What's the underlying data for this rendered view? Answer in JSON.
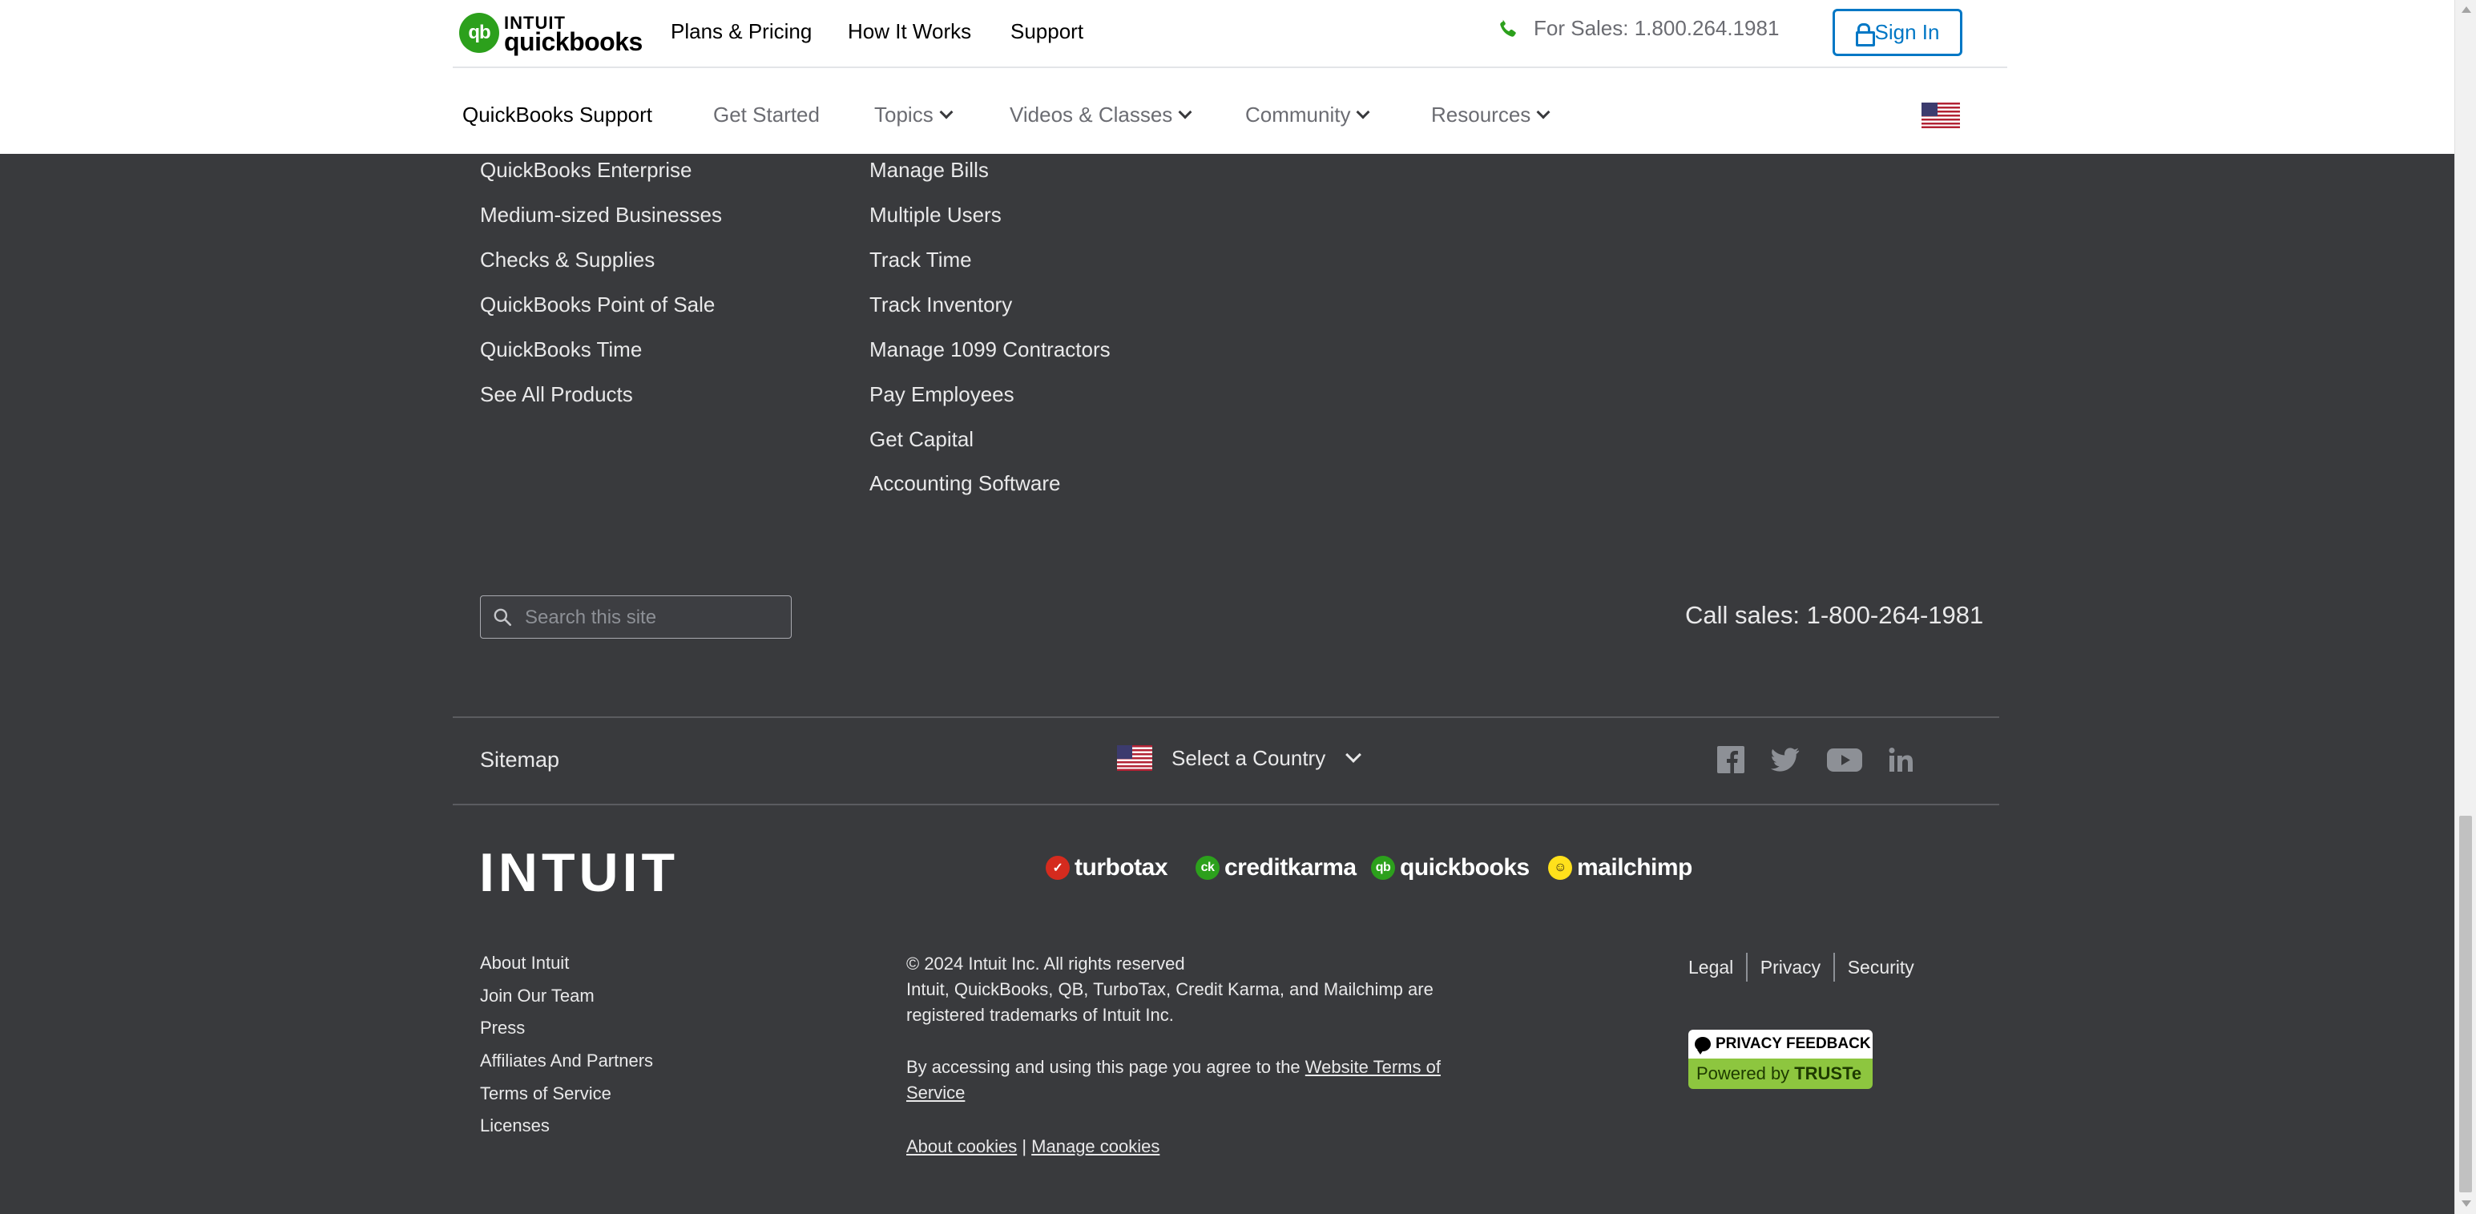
{
  "header": {
    "logo_intuit": "INTUIT",
    "logo_product": "quickbooks",
    "nav": [
      "Plans & Pricing",
      "How It Works",
      "Support"
    ],
    "sales_text": "For Sales: 1.800.264.1981",
    "sign_in": "Sign In"
  },
  "subnav": {
    "items": [
      {
        "label": "QuickBooks Support",
        "dropdown": false
      },
      {
        "label": "Get Started",
        "dropdown": false
      },
      {
        "label": "Topics",
        "dropdown": true
      },
      {
        "label": "Videos & Classes",
        "dropdown": true
      },
      {
        "label": "Community",
        "dropdown": true
      },
      {
        "label": "Resources",
        "dropdown": true
      }
    ]
  },
  "footer": {
    "products_col": [
      "QuickBooks Enterprise",
      "Medium-sized Businesses",
      "Checks & Supplies",
      "QuickBooks Point of Sale",
      "QuickBooks Time",
      "See All Products"
    ],
    "features_col": [
      "Manage Bills",
      "Multiple Users",
      "Track Time",
      "Track Inventory",
      "Manage 1099 Contractors",
      "Pay Employees",
      "Get Capital",
      "Accounting Software"
    ],
    "search_placeholder": "Search this site",
    "call_sales": "Call sales: 1-800-264-1981",
    "sitemap": "Sitemap",
    "select_country": "Select a Country",
    "social": [
      "facebook-icon",
      "twitter-icon",
      "youtube-icon",
      "linkedin-icon"
    ],
    "intuit_wordmark": "INTUIT",
    "brands": [
      {
        "name": "turbotax",
        "badge": "✓",
        "color": "#d52b1e"
      },
      {
        "name": "creditkarma",
        "badge": "ck",
        "color": "#2ca01c"
      },
      {
        "name": "quickbooks",
        "badge": "qb",
        "color": "#2ca01c"
      },
      {
        "name": "mailchimp",
        "badge": "☺",
        "color": "#ffe01b"
      }
    ],
    "company_links": [
      "About Intuit",
      "Join Our Team",
      "Press",
      "Affiliates And Partners",
      "Terms of Service",
      "Licenses"
    ],
    "copyright": "© 2024 Intuit Inc. All rights reserved",
    "trademarks": "Intuit, QuickBooks, QB, TurboTax, Credit Karma, and Mailchimp are registered trademarks of Intuit Inc.",
    "terms_prefix": "By accessing and using this page you agree to the",
    "terms_link": "Website Terms of Service",
    "about_cookies": "About cookies",
    "manage_cookies": "Manage cookies",
    "legal_links": [
      "Legal",
      "Privacy",
      "Security"
    ],
    "truste_top": "PRIVACY FEEDBACK",
    "truste_bottom_prefix": "Powered by",
    "truste_bottom_brand": "TRUSTe"
  },
  "colors": {
    "footer_bg": "#393a3d",
    "brand_green": "#2ca01c",
    "link_blue": "#0077c5"
  }
}
